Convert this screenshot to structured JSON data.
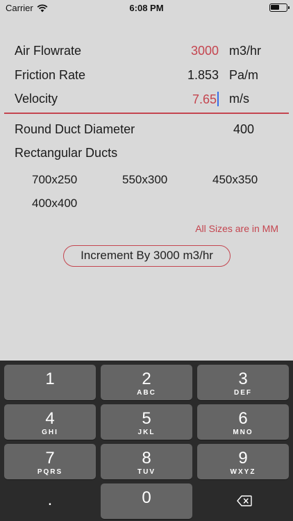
{
  "status_bar": {
    "carrier": "Carrier",
    "time": "6:08 PM"
  },
  "inputs": [
    {
      "label": "Air Flowrate",
      "value": "3000",
      "unit": "m3/hr"
    },
    {
      "label": "Friction Rate",
      "value": "1.853",
      "unit": "Pa/m"
    },
    {
      "label": "Velocity",
      "value": "7.65",
      "unit": "m/s"
    }
  ],
  "round_duct": {
    "label": "Round Duct Diameter",
    "value": "400"
  },
  "rectangular": {
    "label": "Rectangular Ducts",
    "sizes": [
      "700x250",
      "550x300",
      "450x350",
      "400x400"
    ]
  },
  "note": "All Sizes are in MM",
  "increment_button": "Increment By 3000 m3/hr",
  "keypad": {
    "keys": [
      {
        "digit": "1",
        "letters": ""
      },
      {
        "digit": "2",
        "letters": "ABC"
      },
      {
        "digit": "3",
        "letters": "DEF"
      },
      {
        "digit": "4",
        "letters": "GHI"
      },
      {
        "digit": "5",
        "letters": "JKL"
      },
      {
        "digit": "6",
        "letters": "MNO"
      },
      {
        "digit": "7",
        "letters": "PQRS"
      },
      {
        "digit": "8",
        "letters": "TUV"
      },
      {
        "digit": "9",
        "letters": "WXYZ"
      }
    ],
    "dot": ".",
    "zero": "0"
  },
  "colors": {
    "accent": "#c4454f",
    "cursor": "#3a6ee8",
    "keyboard_bg": "#2b2b2b",
    "key_bg": "#656565"
  }
}
